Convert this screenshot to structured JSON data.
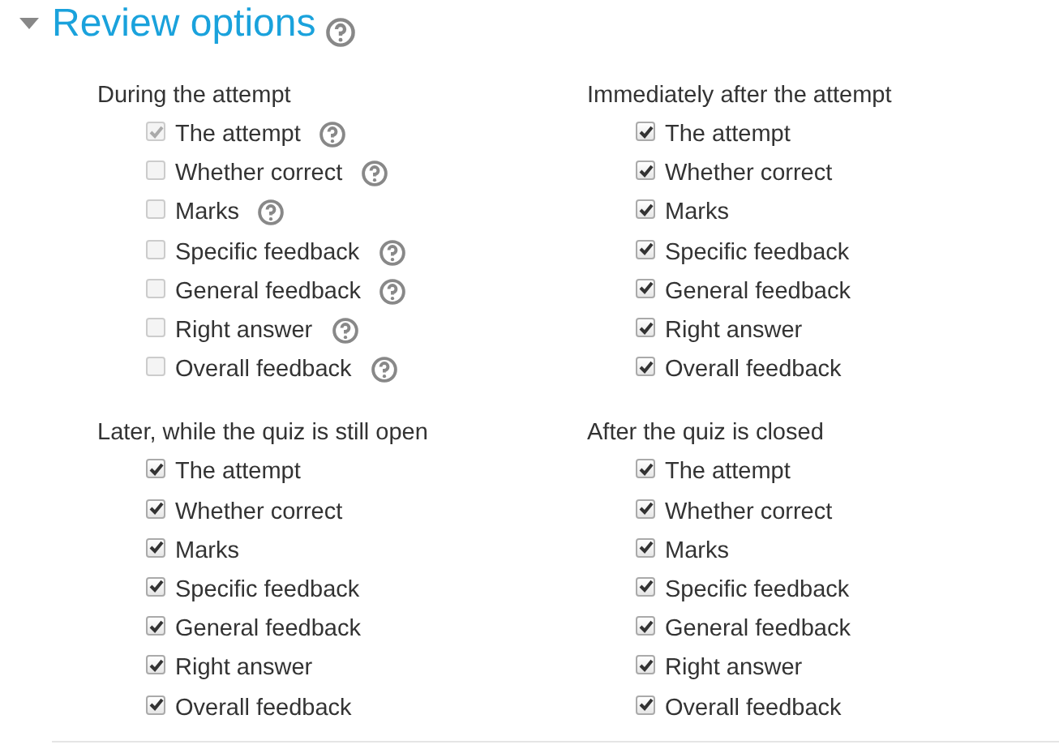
{
  "section": {
    "title": "Review options",
    "expanded": true
  },
  "groups": [
    {
      "title": "During the attempt",
      "options": [
        {
          "label": "The attempt",
          "checked": true,
          "disabled": true,
          "help": true
        },
        {
          "label": "Whether correct",
          "checked": false,
          "disabled": true,
          "help": true
        },
        {
          "label": "Marks",
          "checked": false,
          "disabled": true,
          "help": true
        },
        {
          "label": "Specific feedback",
          "checked": false,
          "disabled": true,
          "help": true
        },
        {
          "label": "General feedback",
          "checked": false,
          "disabled": true,
          "help": true
        },
        {
          "label": "Right answer",
          "checked": false,
          "disabled": true,
          "help": true
        },
        {
          "label": "Overall feedback",
          "checked": false,
          "disabled": true,
          "help": true
        }
      ]
    },
    {
      "title": "Immediately after the attempt",
      "options": [
        {
          "label": "The attempt",
          "checked": true,
          "disabled": false,
          "help": false
        },
        {
          "label": "Whether correct",
          "checked": true,
          "disabled": false,
          "help": false
        },
        {
          "label": "Marks",
          "checked": true,
          "disabled": false,
          "help": false
        },
        {
          "label": "Specific feedback",
          "checked": true,
          "disabled": false,
          "help": false
        },
        {
          "label": "General feedback",
          "checked": true,
          "disabled": false,
          "help": false
        },
        {
          "label": "Right answer",
          "checked": true,
          "disabled": false,
          "help": false
        },
        {
          "label": "Overall feedback",
          "checked": true,
          "disabled": false,
          "help": false
        }
      ]
    },
    {
      "title": "Later, while the quiz is still open",
      "options": [
        {
          "label": "The attempt",
          "checked": true,
          "disabled": false,
          "help": false
        },
        {
          "label": "Whether correct",
          "checked": true,
          "disabled": false,
          "help": false
        },
        {
          "label": "Marks",
          "checked": true,
          "disabled": false,
          "help": false
        },
        {
          "label": "Specific feedback",
          "checked": true,
          "disabled": false,
          "help": false
        },
        {
          "label": "General feedback",
          "checked": true,
          "disabled": false,
          "help": false
        },
        {
          "label": "Right answer",
          "checked": true,
          "disabled": false,
          "help": false
        },
        {
          "label": "Overall feedback",
          "checked": true,
          "disabled": false,
          "help": false
        }
      ]
    },
    {
      "title": "After the quiz is closed",
      "options": [
        {
          "label": "The attempt",
          "checked": true,
          "disabled": false,
          "help": false
        },
        {
          "label": "Whether correct",
          "checked": true,
          "disabled": false,
          "help": false
        },
        {
          "label": "Marks",
          "checked": true,
          "disabled": false,
          "help": false
        },
        {
          "label": "Specific feedback",
          "checked": true,
          "disabled": false,
          "help": false
        },
        {
          "label": "General feedback",
          "checked": true,
          "disabled": false,
          "help": false
        },
        {
          "label": "Right answer",
          "checked": true,
          "disabled": false,
          "help": false
        },
        {
          "label": "Overall feedback",
          "checked": true,
          "disabled": false,
          "help": false
        }
      ]
    }
  ]
}
